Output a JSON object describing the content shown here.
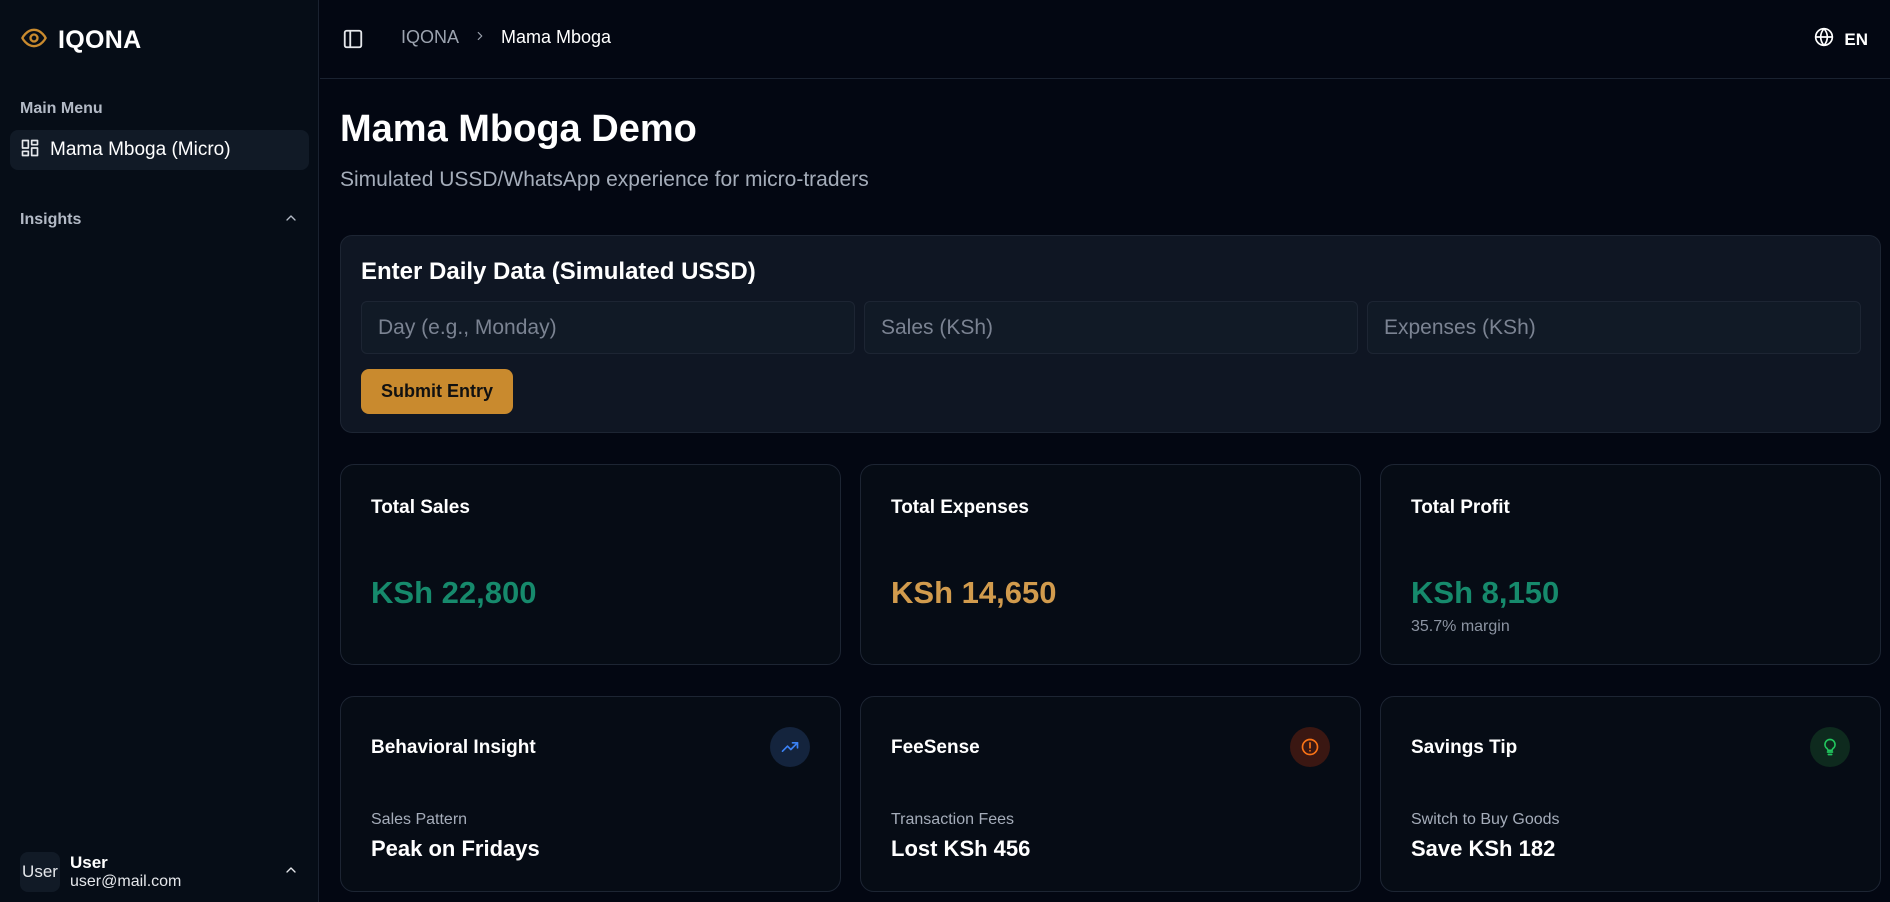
{
  "sidebar": {
    "brand": "IQONA",
    "main_menu_label": "Main Menu",
    "nav_item_label": "Mama Mboga (Micro)",
    "insights_label": "Insights",
    "user": {
      "avatar_text": "User",
      "name": "User",
      "email": "user@mail.com"
    }
  },
  "header": {
    "breadcrumb_root": "IQONA",
    "breadcrumb_current": "Mama Mboga",
    "language": "EN"
  },
  "page": {
    "title": "Mama Mboga Demo",
    "subtitle": "Simulated USSD/WhatsApp experience for micro-traders"
  },
  "entry": {
    "title": "Enter Daily Data (Simulated USSD)",
    "day_placeholder": "Day (e.g., Monday)",
    "sales_placeholder": "Sales (KSh)",
    "expenses_placeholder": "Expenses (KSh)",
    "submit_label": "Submit Entry"
  },
  "stats": {
    "sales": {
      "label": "Total Sales",
      "value": "KSh 22,800",
      "color": "#168a6c"
    },
    "expenses": {
      "label": "Total Expenses",
      "value": "KSh 14,650",
      "color": "#d19b4d"
    },
    "profit": {
      "label": "Total Profit",
      "value": "KSh 8,150",
      "note": "35.7% margin",
      "color": "#168a6c"
    }
  },
  "insights": {
    "behavioral": {
      "title": "Behavioral Insight",
      "sub": "Sales Pattern",
      "value": "Peak on Fridays",
      "icon": "trending-up-icon"
    },
    "feesense": {
      "title": "FeeSense",
      "sub": "Transaction Fees",
      "value": "Lost KSh 456",
      "icon": "alert-circle-icon"
    },
    "savings": {
      "title": "Savings Tip",
      "sub": "Switch to Buy Goods",
      "value": "Save KSh 182",
      "icon": "lightbulb-icon"
    }
  },
  "colors": {
    "brand_accent": "#c98a2e",
    "background": "#030712",
    "card": "#060c15"
  }
}
